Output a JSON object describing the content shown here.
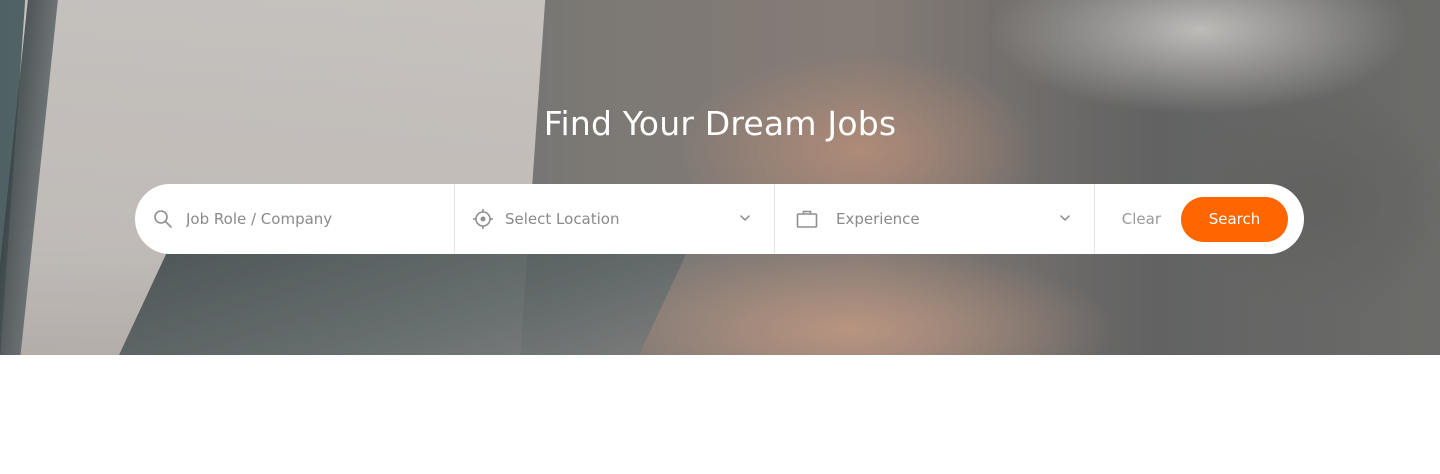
{
  "hero": {
    "title": "Find Your Dream Jobs"
  },
  "search": {
    "keyword_placeholder": "Job Role / Company",
    "location_label": "Select Location",
    "experience_label": "Experience",
    "clear_label": "Clear",
    "search_label": "Search"
  },
  "icons": {
    "keyword": "search-icon",
    "location": "crosshair-icon",
    "experience": "briefcase-icon",
    "dropdown": "chevron-down-icon"
  },
  "colors": {
    "accent": "#ff6600",
    "text_muted": "#8a8a8a",
    "background": "#ffffff"
  }
}
